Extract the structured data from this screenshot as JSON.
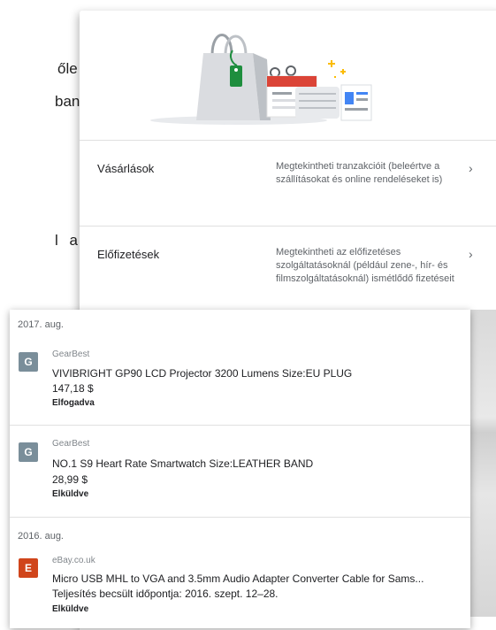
{
  "document": {
    "frag_line1": "ő",
    "frag_line1b": "le",
    "frag_line2": "ban",
    "frag_line3": "l a"
  },
  "menu": {
    "items": [
      {
        "title": "Vásárlások",
        "description": "Megtekintheti tranzakcióit (beleértve a szállításokat és online rendeléseket is)"
      },
      {
        "title": "Előfizetések",
        "description": "Megtekintheti az előfizetéses szolgáltatásoknál (például zene-, hír- és filmszolgáltatásoknál) ismétlődő fizetéseit"
      }
    ],
    "chevron": "›"
  },
  "transactions": {
    "groups": [
      {
        "date": "2017. aug.",
        "items": [
          {
            "avatar_letter": "G",
            "avatar_color": "#7a8e9a",
            "merchant": "GearBest",
            "item": "VIVIBRIGHT GP90 LCD Projector 3200 Lumens Size:EU PLUG",
            "price": "147,18 $",
            "status": "Elfogadva"
          },
          {
            "avatar_letter": "G",
            "avatar_color": "#7a8e9a",
            "merchant": "GearBest",
            "item": "NO.1 S9 Heart Rate Smartwatch Size:LEATHER BAND",
            "price": "28,99 $",
            "status": "Elküldve"
          }
        ]
      },
      {
        "date": "2016. aug.",
        "items": [
          {
            "avatar_letter": "E",
            "avatar_color": "#d0451b",
            "merchant": "eBay.co.uk",
            "item": "Micro USB MHL to VGA and 3.5mm Audio Adapter Converter Cable for Sams...",
            "subline": "Teljesítés becsült időpontja: 2016. szept. 12–28.",
            "status": "Elküldve"
          }
        ]
      }
    ]
  },
  "colors": {
    "accent_green": "#1e8e3e",
    "accent_red": "#db4437",
    "accent_blue": "#4285f4",
    "accent_yellow": "#fbbc04"
  }
}
